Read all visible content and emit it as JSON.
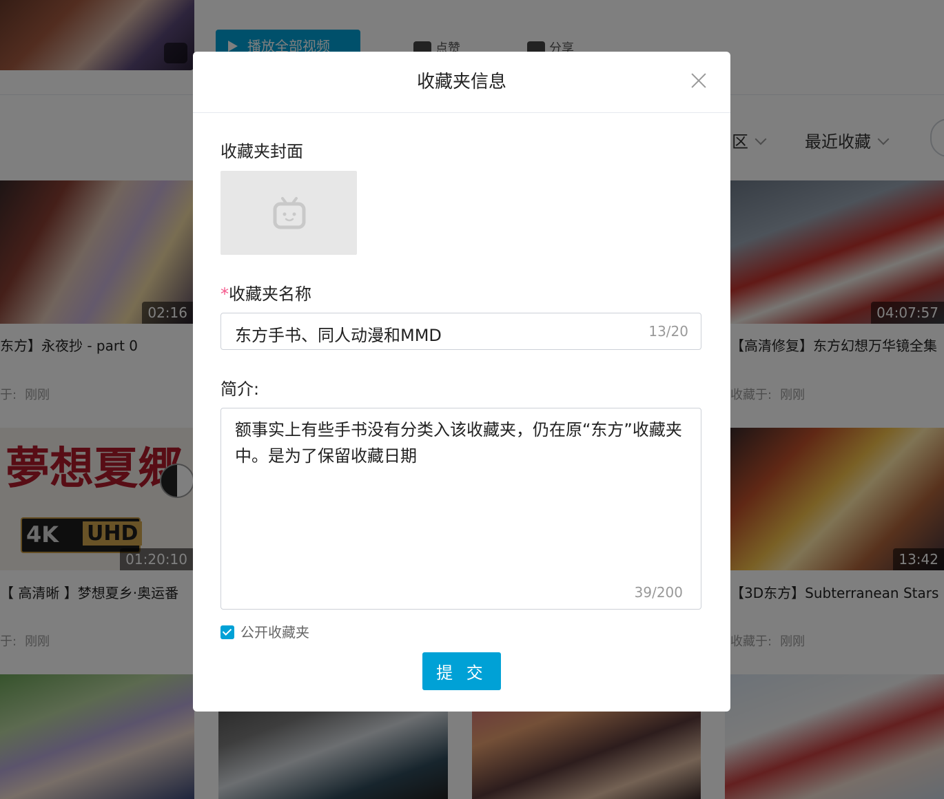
{
  "header": {
    "play_all_label": "播放全部视频",
    "like_label": "点赞",
    "share_label": "分享"
  },
  "filters": {
    "zone_label": "区",
    "sort_label": "最近收藏"
  },
  "videos": [
    {
      "title": "东方】永夜抄 - part 0",
      "duration": "02:16",
      "fav_label": "于:",
      "fav_time": "刚刚"
    },
    {
      "title": "【高清修复】东方幻想万华镜全集",
      "duration": "04:07:57",
      "fav_label": "收藏于:",
      "fav_time": "刚刚"
    },
    {
      "title": "【 高清晰 】梦想夏乡·奥运番",
      "duration": "01:20:10",
      "fav_label": "于:",
      "fav_time": "刚刚"
    },
    {
      "title": "【3D东方】Subterranean Stars",
      "duration": "13:42",
      "fav_label": "收藏于:",
      "fav_time": "刚刚"
    }
  ],
  "thumb_text": {
    "title_art": "夢想夏郷",
    "badge_4k": "4K",
    "badge_uhd": "UHD"
  },
  "modal": {
    "title": "收藏夹信息",
    "cover_label": "收藏夹封面",
    "required_mark": "*",
    "name_label": "收藏夹名称",
    "name_value": "东方手书、同人动漫和MMD",
    "name_count": "13/20",
    "desc_label": "简介:",
    "desc_value": "额事实上有些手书没有分类入该收藏夹，仍在原“东方”收藏夹中。是为了保留收藏日期",
    "desc_count": "39/200",
    "public_label": "公开收藏夹",
    "public_checked": true,
    "submit_label": "提 交"
  },
  "colors": {
    "accent": "#00a1d6",
    "required": "#f45a8d",
    "border": "#ccd0d7"
  }
}
